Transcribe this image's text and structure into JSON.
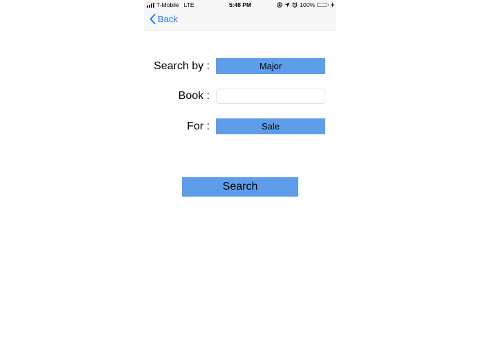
{
  "status_bar": {
    "carrier": "T-Mobile",
    "network": "LTE",
    "time": "5:48 PM",
    "battery_percent": "100%",
    "battery_level": 1.0,
    "icons": [
      "signal-bars-icon",
      "screen-lock-icon",
      "location-arrow-icon",
      "alarm-clock-icon",
      "battery-icon",
      "charging-bolt-icon"
    ],
    "battery_color": "#4cd964"
  },
  "nav": {
    "back_label": "Back",
    "tint_color": "#1a7cf5"
  },
  "form": {
    "search_by_label": "Search by :",
    "search_by_value": "Major",
    "book_label": "Book :",
    "book_value": "",
    "book_placeholder": "",
    "for_label": "For :",
    "for_value": "Sale",
    "search_button_label": "Search",
    "button_color": "#5e9de9"
  }
}
